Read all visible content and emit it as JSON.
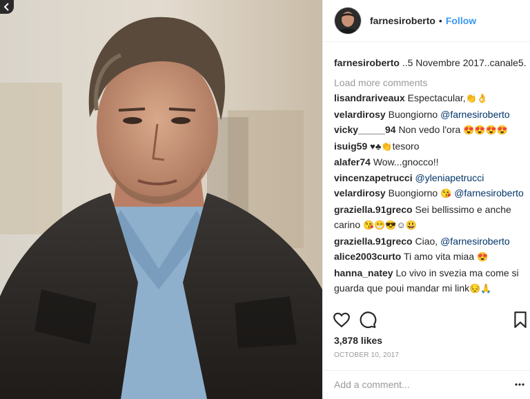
{
  "post": {
    "username": "farnesiroberto",
    "separator": "•",
    "follow_label": "Follow",
    "caption_user": "farnesiroberto",
    "caption_text": "..5 Novembre 2017..canale5.",
    "load_more": "Load more comments",
    "likes": "3,878 likes",
    "date": "OCTOBER 10, 2017",
    "add_comment_placeholder": "Add a comment..."
  },
  "comments": [
    {
      "user": "lisandrariveaux",
      "text": "Espectacular,",
      "emoji": "👏👌"
    },
    {
      "user": "velardirosy",
      "text": "Buongiorno",
      "mention": "@farnesiroberto"
    },
    {
      "user": "vicky_____94",
      "text": "Non vedo l'ora",
      "emoji": "😍😍😍😍"
    },
    {
      "user": "isuig59",
      "emoji": "♥♣👏",
      "text": "tesoro"
    },
    {
      "user": "alafer74",
      "text": "Wow...gnocco!!"
    },
    {
      "user": "vincenzapetrucci",
      "mention": "@yleniapetrucci"
    },
    {
      "user": "velardirosy",
      "text": "Buongiorno",
      "emoji": "😘",
      "mention": "@farnesiroberto"
    },
    {
      "user": "graziella.91greco",
      "text": "Sei bellissimo e anche carino",
      "emoji": "😘😁😎☺😃"
    },
    {
      "user": "graziella.91greco",
      "text": "Ciao,",
      "mention": "@farnesiroberto"
    },
    {
      "user": "alice2003curto",
      "text": "Ti amo vita miaa",
      "emoji": "😍"
    },
    {
      "user": "hanna_natey",
      "text": "Lo vivo in svezia ma come si guarda que poui mandar mi link",
      "emoji": "😔🙏"
    }
  ],
  "icons": {
    "back": "chevron-left-icon",
    "like": "heart-icon",
    "comment": "comment-icon",
    "save": "bookmark-icon",
    "more": "ellipsis-icon"
  },
  "colors": {
    "link": "#3897f0",
    "mention": "#003569",
    "muted": "#999999",
    "text": "#262626"
  }
}
